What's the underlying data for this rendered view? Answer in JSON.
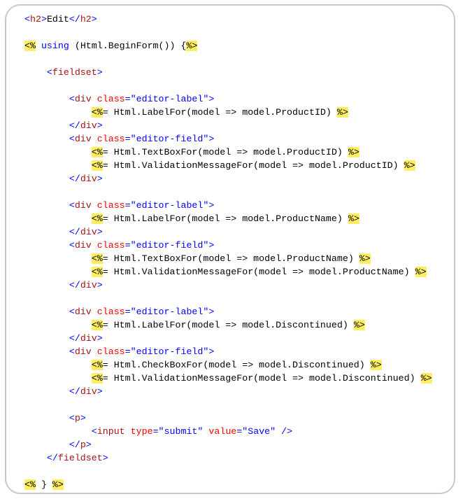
{
  "colors": {
    "delimiter": "#0000ff",
    "tag_name": "#a31515",
    "attribute": "#ff0000",
    "string": "#0000ff",
    "server_tag_highlight": "#ffee62"
  },
  "code_lines": [
    [
      [
        "<",
        "d"
      ],
      [
        "h2",
        "n"
      ],
      [
        ">",
        "d"
      ],
      [
        "Edit",
        "t"
      ],
      [
        "</",
        "d"
      ],
      [
        "h2",
        "n"
      ],
      [
        ">",
        "d"
      ]
    ],
    [],
    [
      [
        "<%",
        "h"
      ],
      [
        " ",
        "t"
      ],
      [
        "using",
        "k"
      ],
      [
        " (Html.BeginForm()) {",
        "t"
      ],
      [
        "%>",
        "h"
      ]
    ],
    [],
    [
      [
        "    ",
        "t"
      ],
      [
        "<",
        "d"
      ],
      [
        "fieldset",
        "n"
      ],
      [
        ">",
        "d"
      ]
    ],
    [],
    [
      [
        "        ",
        "t"
      ],
      [
        "<",
        "d"
      ],
      [
        "div",
        "n"
      ],
      [
        " ",
        "t"
      ],
      [
        "class",
        "a"
      ],
      [
        "=",
        "d"
      ],
      [
        "\"editor-label\"",
        "s"
      ],
      [
        ">",
        "d"
      ]
    ],
    [
      [
        "            ",
        "t"
      ],
      [
        "<%",
        "h"
      ],
      [
        "= Html.LabelFor(model => model.ProductID) ",
        "t"
      ],
      [
        "%>",
        "h"
      ]
    ],
    [
      [
        "        ",
        "t"
      ],
      [
        "</",
        "d"
      ],
      [
        "div",
        "n"
      ],
      [
        ">",
        "d"
      ]
    ],
    [
      [
        "        ",
        "t"
      ],
      [
        "<",
        "d"
      ],
      [
        "div",
        "n"
      ],
      [
        " ",
        "t"
      ],
      [
        "class",
        "a"
      ],
      [
        "=",
        "d"
      ],
      [
        "\"editor-field\"",
        "s"
      ],
      [
        ">",
        "d"
      ]
    ],
    [
      [
        "            ",
        "t"
      ],
      [
        "<%",
        "h"
      ],
      [
        "= Html.TextBoxFor(model => model.ProductID) ",
        "t"
      ],
      [
        "%>",
        "h"
      ]
    ],
    [
      [
        "            ",
        "t"
      ],
      [
        "<%",
        "h"
      ],
      [
        "= Html.ValidationMessageFor(model => model.ProductID) ",
        "t"
      ],
      [
        "%>",
        "h"
      ]
    ],
    [
      [
        "        ",
        "t"
      ],
      [
        "</",
        "d"
      ],
      [
        "div",
        "n"
      ],
      [
        ">",
        "d"
      ]
    ],
    [],
    [
      [
        "        ",
        "t"
      ],
      [
        "<",
        "d"
      ],
      [
        "div",
        "n"
      ],
      [
        " ",
        "t"
      ],
      [
        "class",
        "a"
      ],
      [
        "=",
        "d"
      ],
      [
        "\"editor-label\"",
        "s"
      ],
      [
        ">",
        "d"
      ]
    ],
    [
      [
        "            ",
        "t"
      ],
      [
        "<%",
        "h"
      ],
      [
        "= Html.LabelFor(model => model.ProductName) ",
        "t"
      ],
      [
        "%>",
        "h"
      ]
    ],
    [
      [
        "        ",
        "t"
      ],
      [
        "</",
        "d"
      ],
      [
        "div",
        "n"
      ],
      [
        ">",
        "d"
      ]
    ],
    [
      [
        "        ",
        "t"
      ],
      [
        "<",
        "d"
      ],
      [
        "div",
        "n"
      ],
      [
        " ",
        "t"
      ],
      [
        "class",
        "a"
      ],
      [
        "=",
        "d"
      ],
      [
        "\"editor-field\"",
        "s"
      ],
      [
        ">",
        "d"
      ]
    ],
    [
      [
        "            ",
        "t"
      ],
      [
        "<%",
        "h"
      ],
      [
        "= Html.TextBoxFor(model => model.ProductName) ",
        "t"
      ],
      [
        "%>",
        "h"
      ]
    ],
    [
      [
        "            ",
        "t"
      ],
      [
        "<%",
        "h"
      ],
      [
        "= Html.ValidationMessageFor(model => model.ProductName) ",
        "t"
      ],
      [
        "%>",
        "h"
      ]
    ],
    [
      [
        "        ",
        "t"
      ],
      [
        "</",
        "d"
      ],
      [
        "div",
        "n"
      ],
      [
        ">",
        "d"
      ]
    ],
    [],
    [
      [
        "        ",
        "t"
      ],
      [
        "<",
        "d"
      ],
      [
        "div",
        "n"
      ],
      [
        " ",
        "t"
      ],
      [
        "class",
        "a"
      ],
      [
        "=",
        "d"
      ],
      [
        "\"editor-label\"",
        "s"
      ],
      [
        ">",
        "d"
      ]
    ],
    [
      [
        "            ",
        "t"
      ],
      [
        "<%",
        "h"
      ],
      [
        "= Html.LabelFor(model => model.Discontinued) ",
        "t"
      ],
      [
        "%>",
        "h"
      ]
    ],
    [
      [
        "        ",
        "t"
      ],
      [
        "</",
        "d"
      ],
      [
        "div",
        "n"
      ],
      [
        ">",
        "d"
      ]
    ],
    [
      [
        "        ",
        "t"
      ],
      [
        "<",
        "d"
      ],
      [
        "div",
        "n"
      ],
      [
        " ",
        "t"
      ],
      [
        "class",
        "a"
      ],
      [
        "=",
        "d"
      ],
      [
        "\"editor-field\"",
        "s"
      ],
      [
        ">",
        "d"
      ]
    ],
    [
      [
        "            ",
        "t"
      ],
      [
        "<%",
        "h"
      ],
      [
        "= Html.CheckBoxFor(model => model.Discontinued) ",
        "t"
      ],
      [
        "%>",
        "h"
      ]
    ],
    [
      [
        "            ",
        "t"
      ],
      [
        "<%",
        "h"
      ],
      [
        "= Html.ValidationMessageFor(model => model.Discontinued) ",
        "t"
      ],
      [
        "%>",
        "h"
      ]
    ],
    [
      [
        "        ",
        "t"
      ],
      [
        "</",
        "d"
      ],
      [
        "div",
        "n"
      ],
      [
        ">",
        "d"
      ]
    ],
    [],
    [
      [
        "        ",
        "t"
      ],
      [
        "<",
        "d"
      ],
      [
        "p",
        "n"
      ],
      [
        ">",
        "d"
      ]
    ],
    [
      [
        "            ",
        "t"
      ],
      [
        "<",
        "d"
      ],
      [
        "input",
        "n"
      ],
      [
        " ",
        "t"
      ],
      [
        "type",
        "a"
      ],
      [
        "=",
        "d"
      ],
      [
        "\"submit\"",
        "s"
      ],
      [
        " ",
        "t"
      ],
      [
        "value",
        "a"
      ],
      [
        "=",
        "d"
      ],
      [
        "\"Save\"",
        "s"
      ],
      [
        " />",
        "d"
      ]
    ],
    [
      [
        "        ",
        "t"
      ],
      [
        "</",
        "d"
      ],
      [
        "p",
        "n"
      ],
      [
        ">",
        "d"
      ]
    ],
    [
      [
        "    ",
        "t"
      ],
      [
        "</",
        "d"
      ],
      [
        "fieldset",
        "n"
      ],
      [
        ">",
        "d"
      ]
    ],
    [],
    [
      [
        "<%",
        "h"
      ],
      [
        " } ",
        "t"
      ],
      [
        "%>",
        "h"
      ]
    ]
  ]
}
